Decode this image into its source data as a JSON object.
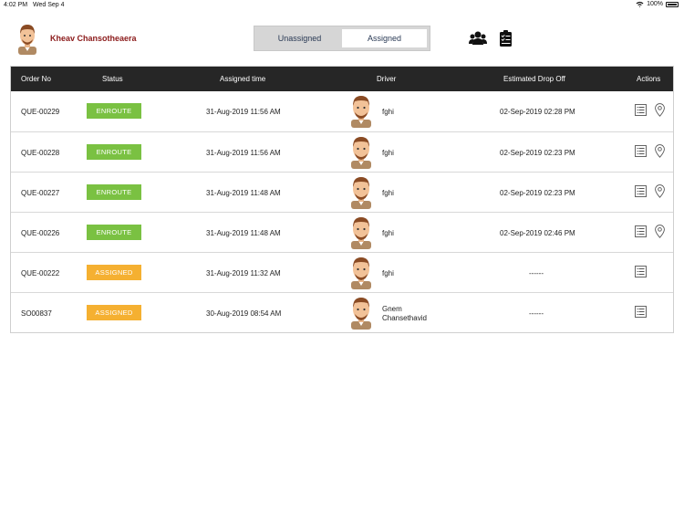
{
  "status_bar": {
    "time": "4:02 PM",
    "date": "Wed Sep 4",
    "battery": "100%"
  },
  "header": {
    "user_name": "Kheav Chansotheaera",
    "tabs": [
      {
        "label": "Unassigned",
        "active": false
      },
      {
        "label": "Assigned",
        "active": true
      }
    ],
    "icons": [
      "group-icon",
      "clipboard-check-icon"
    ]
  },
  "table": {
    "columns": [
      "Order No",
      "Status",
      "Assigned time",
      "Driver",
      "Estimated Drop Off",
      "Actions"
    ],
    "rows": [
      {
        "order_no": "QUE-00229",
        "status": "ENROUTE",
        "assigned_time": "31-Aug-2019 11:56 AM",
        "driver": "fghi",
        "eta": "02-Sep-2019 02:28 PM",
        "has_location": true
      },
      {
        "order_no": "QUE-00228",
        "status": "ENROUTE",
        "assigned_time": "31-Aug-2019 11:56 AM",
        "driver": "fghi",
        "eta": "02-Sep-2019 02:23 PM",
        "has_location": true
      },
      {
        "order_no": "QUE-00227",
        "status": "ENROUTE",
        "assigned_time": "31-Aug-2019 11:48 AM",
        "driver": "fghi",
        "eta": "02-Sep-2019 02:23 PM",
        "has_location": true
      },
      {
        "order_no": "QUE-00226",
        "status": "ENROUTE",
        "assigned_time": "31-Aug-2019 11:48 AM",
        "driver": "fghi",
        "eta": "02-Sep-2019 02:46 PM",
        "has_location": true
      },
      {
        "order_no": "QUE-00222",
        "status": "ASSIGNED",
        "assigned_time": "31-Aug-2019 11:32 AM",
        "driver": "fghi",
        "eta": "------",
        "has_location": false
      },
      {
        "order_no": "SO00837",
        "status": "ASSIGNED",
        "assigned_time": "30-Aug-2019 08:54 AM",
        "driver_line1": "Gnem",
        "driver_line2": "Chansethavid",
        "eta": "------",
        "has_location": false
      }
    ]
  },
  "colors": {
    "enroute": "#7ac142",
    "assigned": "#f5b031",
    "header_bg": "#262626",
    "user_name": "#8b1a1a"
  }
}
